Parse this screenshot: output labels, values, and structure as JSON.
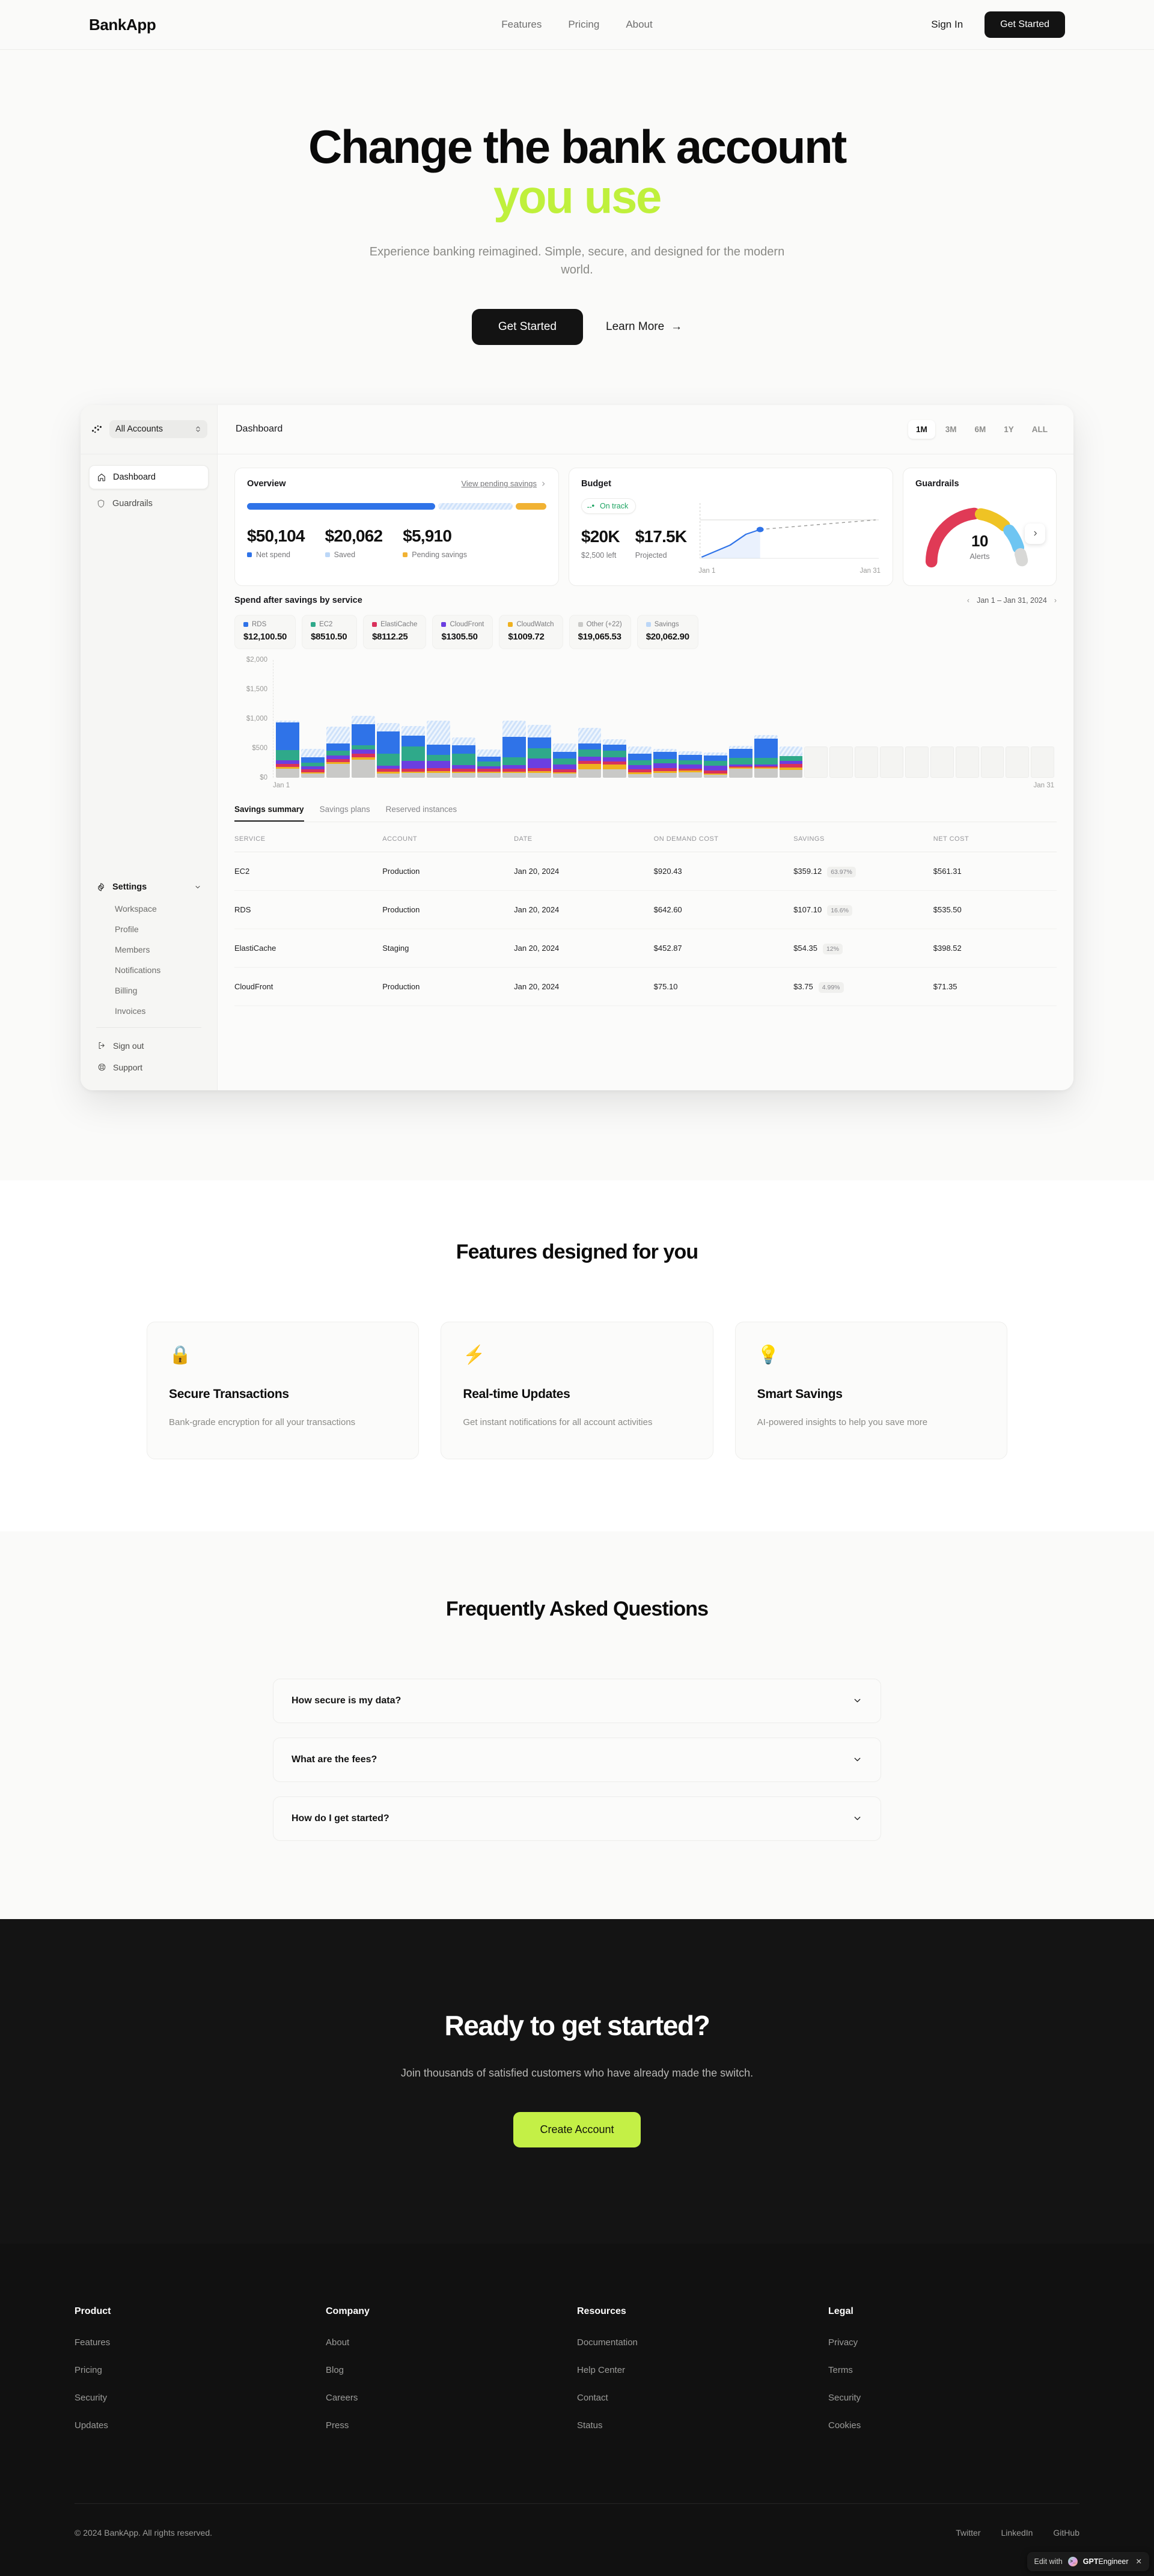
{
  "header": {
    "brand": "BankApp",
    "nav": [
      {
        "label": "Features"
      },
      {
        "label": "Pricing"
      },
      {
        "label": "About"
      }
    ],
    "signin_label": "Sign In",
    "get_started_label": "Get Started"
  },
  "hero": {
    "title_line1": "Change the bank account",
    "title_line2": "you use",
    "accent_color": "#bff03c",
    "subtitle": "Experience banking reimagined. Simple, secure, and designed for the modern world.",
    "primary_cta": "Get Started",
    "secondary_cta": "Learn More",
    "secondary_cta_icon": "arrow-right-icon"
  },
  "dashboard": {
    "account_switcher": {
      "label": "All Accounts",
      "icon": "app-logo-icon",
      "chevron": "chevron-updown-icon"
    },
    "nav": [
      {
        "label": "Dashboard",
        "icon": "home-icon",
        "active": true
      },
      {
        "label": "Guardrails",
        "icon": "shield-icon",
        "active": false
      }
    ],
    "settings": {
      "label": "Settings",
      "icon": "gear-icon",
      "chevron": "chevron-down-icon",
      "items": [
        {
          "label": "Workspace"
        },
        {
          "label": "Profile"
        },
        {
          "label": "Members"
        },
        {
          "label": "Notifications"
        },
        {
          "label": "Billing"
        },
        {
          "label": "Invoices"
        }
      ]
    },
    "footer_items": [
      {
        "label": "Sign out",
        "icon": "sign-out-icon"
      },
      {
        "label": "Support",
        "icon": "lifebuoy-icon"
      }
    ],
    "topbar": {
      "title": "Dashboard",
      "ranges": [
        {
          "label": "1M",
          "selected": true
        },
        {
          "label": "3M",
          "selected": false
        },
        {
          "label": "6M",
          "selected": false
        },
        {
          "label": "1Y",
          "selected": false
        },
        {
          "label": "ALL",
          "selected": false
        }
      ]
    },
    "overview": {
      "title": "Overview",
      "link": "View pending savings",
      "link_icon": "chevron-right-icon",
      "bar_segments": [
        {
          "color": "#2f73e8",
          "flex": 61
        },
        {
          "color": "#bcd7f7",
          "flex": 24,
          "hatched": true
        },
        {
          "color": "#f1b233",
          "flex": 10
        }
      ],
      "stats": [
        {
          "value": "$50,104",
          "label": "Net spend",
          "color": "#2f73e8"
        },
        {
          "value": "$20,062",
          "label": "Saved",
          "color": "#bcd7f7"
        },
        {
          "value": "$5,910",
          "label": "Pending savings",
          "color": "#f1b233"
        }
      ]
    },
    "budget": {
      "title": "Budget",
      "status": "On track",
      "status_color": "#1da462",
      "status_icon": "trend-line-icon",
      "stats": [
        {
          "value": "$20K",
          "label": "$2,500 left"
        },
        {
          "value": "$17.5K",
          "label": "Projected"
        }
      ],
      "chart_start": "Jan 1",
      "chart_end": "Jan 31"
    },
    "guardrails": {
      "title": "Guardrails",
      "value": "10",
      "label": "Alerts",
      "next_icon": "chevron-right-icon",
      "gauge_segments": [
        {
          "color": "#e03a56",
          "span": 52
        },
        {
          "color": "#efc324",
          "span": 20
        },
        {
          "color": "#6ec5f2",
          "span": 16
        },
        {
          "color": "#d8d8d6",
          "span": 12
        }
      ]
    },
    "spend": {
      "title": "Spend after savings by service",
      "date_range": "Jan 1 – Jan 31, 2024",
      "prev_icon": "chevron-left-icon",
      "next_icon": "chevron-right-icon",
      "legend": [
        {
          "name": "RDS",
          "amount": "$12,100.50",
          "color": "#2f73e8"
        },
        {
          "name": "EC2",
          "amount": "$8510.50",
          "color": "#2fa98a"
        },
        {
          "name": "ElastiCache",
          "amount": "$8112.25",
          "color": "#d9315b"
        },
        {
          "name": "CloudFront",
          "amount": "$1305.50",
          "color": "#6b3fe0"
        },
        {
          "name": "CloudWatch",
          "amount": "$1009.72",
          "color": "#efb11f"
        },
        {
          "name": "Other (+22)",
          "amount": "$19,065.53",
          "color": "#c9c9c7"
        },
        {
          "name": "Savings",
          "amount": "$20,062.90",
          "color": "#bcd7f7"
        }
      ]
    },
    "tabs": [
      {
        "label": "Savings summary",
        "selected": true
      },
      {
        "label": "Savings plans",
        "selected": false
      },
      {
        "label": "Reserved instances",
        "selected": false
      }
    ],
    "table": {
      "columns": [
        "SERVICE",
        "ACCOUNT",
        "DATE",
        "ON DEMAND COST",
        "SAVINGS",
        "NET COST"
      ],
      "rows": [
        {
          "service": "EC2",
          "account": "Production",
          "date": "Jan 20, 2024",
          "on_demand": "$920.43",
          "savings": "$359.12",
          "pct": "63.97%",
          "net": "$561.31"
        },
        {
          "service": "RDS",
          "account": "Production",
          "date": "Jan 20, 2024",
          "on_demand": "$642.60",
          "savings": "$107.10",
          "pct": "16.6%",
          "net": "$535.50"
        },
        {
          "service": "ElastiCache",
          "account": "Staging",
          "date": "Jan 20, 2024",
          "on_demand": "$452.87",
          "savings": "$54.35",
          "pct": "12%",
          "net": "$398.52"
        },
        {
          "service": "CloudFront",
          "account": "Production",
          "date": "Jan 20, 2024",
          "on_demand": "$75.10",
          "savings": "$3.75",
          "pct": "4.99%",
          "net": "$71.35"
        }
      ]
    }
  },
  "chart_data": {
    "type": "bar",
    "title": "Spend after savings by service",
    "subtitle": "Jan 1 – Jan 31, 2024",
    "xlabel": "",
    "ylabel": "",
    "ylim": [
      0,
      2000
    ],
    "yticks": [
      "$0",
      "$500",
      "$1,000",
      "$1,500",
      "$2,000"
    ],
    "xticks": [
      "Jan 1",
      "Jan 31"
    ],
    "grid": false,
    "legend_position": "top",
    "stacked": true,
    "series": [
      {
        "name": "Other (+22)",
        "color": "#c9c9c7",
        "values": [
          150,
          75,
          230,
          310,
          75,
          80,
          80,
          80,
          80,
          80,
          85,
          70,
          145,
          145,
          60,
          80,
          95,
          50,
          150,
          150,
          130,
          0,
          0,
          0,
          0,
          0,
          0,
          0,
          0,
          0,
          0
        ]
      },
      {
        "name": "CloudWatch",
        "color": "#efb11f",
        "values": [
          30,
          20,
          30,
          35,
          25,
          25,
          30,
          25,
          25,
          25,
          30,
          25,
          85,
          80,
          30,
          30,
          22,
          22,
          22,
          22,
          45,
          0,
          0,
          0,
          0,
          0,
          0,
          0,
          0,
          0,
          0
        ]
      },
      {
        "name": "ElastiCache",
        "color": "#d9315b",
        "values": [
          55,
          45,
          55,
          60,
          50,
          50,
          50,
          50,
          45,
          50,
          50,
          50,
          50,
          45,
          55,
          55,
          40,
          55,
          25,
          25,
          60,
          0,
          0,
          0,
          0,
          0,
          0,
          0,
          0,
          0,
          0
        ]
      },
      {
        "name": "CloudFront",
        "color": "#6b3fe0",
        "values": [
          60,
          55,
          60,
          70,
          55,
          130,
          130,
          60,
          45,
          60,
          160,
          75,
          75,
          75,
          70,
          80,
          65,
          80,
          30,
          30,
          55,
          0,
          0,
          0,
          0,
          0,
          0,
          0,
          0,
          0,
          0
        ]
      },
      {
        "name": "EC2",
        "color": "#2fa98a",
        "values": [
          175,
          55,
          85,
          75,
          200,
          250,
          95,
          195,
          75,
          130,
          170,
          105,
          120,
          115,
          85,
          75,
          70,
          75,
          110,
          110,
          80,
          0,
          0,
          0,
          0,
          0,
          0,
          0,
          0,
          0,
          0
        ]
      },
      {
        "name": "RDS",
        "color": "#2f73e8",
        "values": [
          465,
          95,
          125,
          360,
          385,
          175,
          180,
          145,
          85,
          345,
          185,
          110,
          110,
          105,
          105,
          120,
          100,
          95,
          150,
          330,
          0,
          0,
          0,
          0,
          0,
          0,
          0,
          0,
          0,
          0,
          0
        ]
      },
      {
        "name": "Savings",
        "color": "#bcd7f7",
        "hatched": true,
        "values": [
          35,
          140,
          280,
          140,
          135,
          165,
          400,
          125,
          125,
          275,
          215,
          150,
          260,
          90,
          130,
          50,
          55,
          55,
          55,
          55,
          160,
          0,
          0,
          0,
          0,
          0,
          0,
          0,
          0,
          0,
          0
        ]
      }
    ],
    "empty_bars_from_index": 21,
    "empty_bar_count": 10
  },
  "features": {
    "title": "Features designed for you",
    "cards": [
      {
        "icon": "lock-icon",
        "emoji": "🔒",
        "title": "Secure Transactions",
        "desc": "Bank-grade encryption for all your transactions"
      },
      {
        "icon": "lightning-icon",
        "emoji": "⚡",
        "title": "Real-time Updates",
        "desc": "Get instant notifications for all account activities"
      },
      {
        "icon": "lightbulb-icon",
        "emoji": "💡",
        "title": "Smart Savings",
        "desc": "AI-powered insights to help you save more"
      }
    ]
  },
  "faq": {
    "title": "Frequently Asked Questions",
    "items": [
      {
        "question": "How secure is my data?",
        "icon": "chevron-down-icon"
      },
      {
        "question": "What are the fees?",
        "icon": "chevron-down-icon"
      },
      {
        "question": "How do I get started?",
        "icon": "chevron-down-icon"
      }
    ]
  },
  "cta": {
    "title": "Ready to get started?",
    "subtitle": "Join thousands of satisfied customers who have already made the switch.",
    "button": "Create Account",
    "button_color": "#c4f046"
  },
  "footer": {
    "columns": [
      {
        "heading": "Product",
        "links": [
          "Features",
          "Pricing",
          "Security",
          "Updates"
        ]
      },
      {
        "heading": "Company",
        "links": [
          "About",
          "Blog",
          "Careers",
          "Press"
        ]
      },
      {
        "heading": "Resources",
        "links": [
          "Documentation",
          "Help Center",
          "Contact",
          "Status"
        ]
      },
      {
        "heading": "Legal",
        "links": [
          "Privacy",
          "Terms",
          "Security",
          "Cookies"
        ]
      }
    ],
    "copyright": "© 2024 BankApp. All rights reserved.",
    "socials": [
      "Twitter",
      "LinkedIn",
      "GitHub"
    ]
  },
  "badge": {
    "prefix": "Edit with",
    "brand_bold": "GPT",
    "brand_rest": "Engineer",
    "close_icon": "close-icon"
  }
}
